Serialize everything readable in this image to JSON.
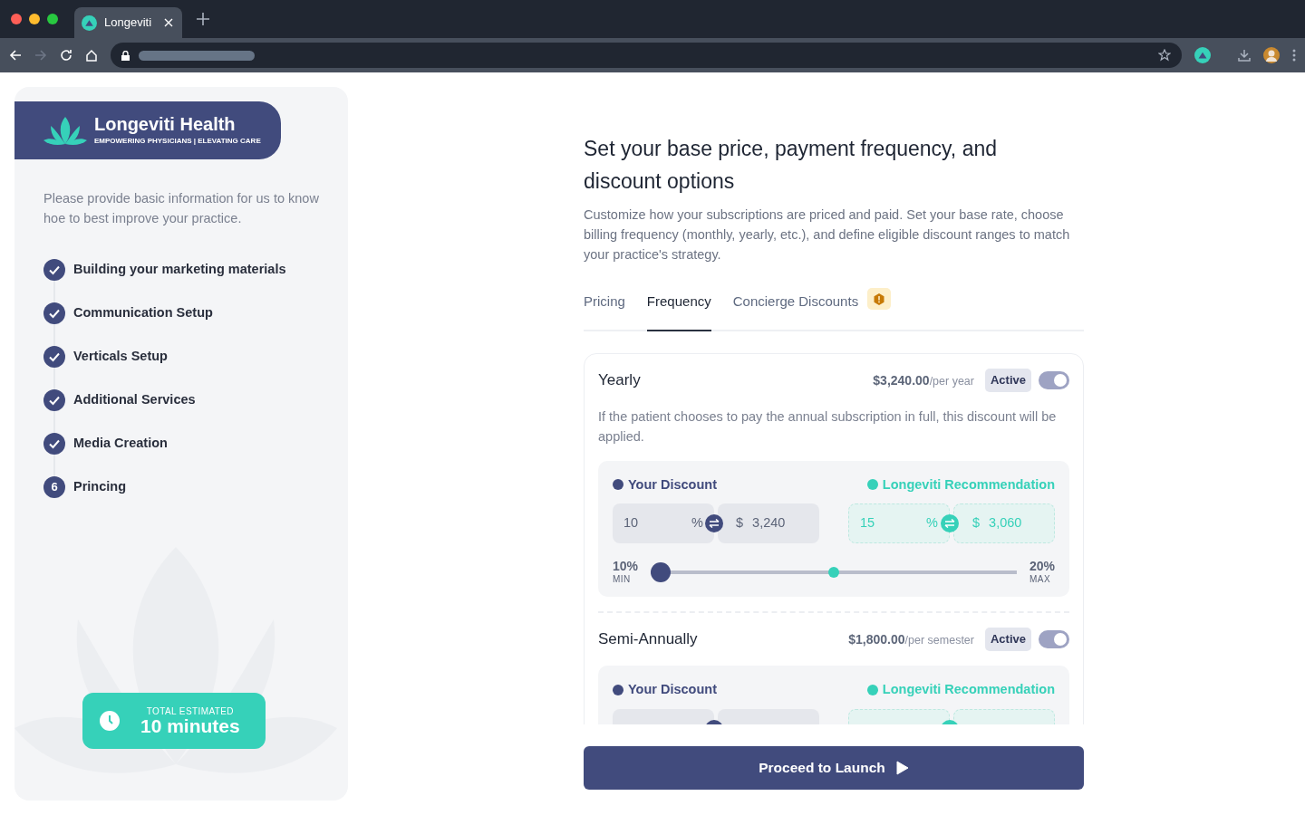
{
  "browser": {
    "tab_title": "Longeviti"
  },
  "sidebar": {
    "brand": "Longeviti Health",
    "tagline": "EMPOWERING PHYSICIANS | ELEVATING CARE",
    "intro": "Please provide basic information for us to know hoe to best improve your practice.",
    "steps": [
      {
        "label": "Building your marketing materials",
        "done": true
      },
      {
        "label": "Communication Setup",
        "done": true
      },
      {
        "label": "Verticals Setup",
        "done": true
      },
      {
        "label": "Additional Services",
        "done": true
      },
      {
        "label": "Media Creation",
        "done": true
      },
      {
        "label": "Princing",
        "done": false,
        "number": "6"
      }
    ],
    "estimate": {
      "label": "TOTAL ESTIMATED",
      "value": "10 minutes"
    }
  },
  "main": {
    "title": "Set your base price, payment frequency, and discount options",
    "description": "Customize how your subscriptions are priced and paid. Set your base rate, choose billing frequency (monthly, yearly, etc.), and define eligible discount ranges to match your practice's strategy.",
    "tabs": [
      {
        "label": "Pricing",
        "selected": false,
        "warning": false
      },
      {
        "label": "Frequency",
        "selected": true,
        "warning": false
      },
      {
        "label": "Concierge Discounts",
        "selected": false,
        "warning": true
      }
    ],
    "frequencies": [
      {
        "name": "Yearly",
        "price": "$3,240.00",
        "unit": "/per year",
        "status": "Active",
        "on": true,
        "description": "If the patient chooses to pay the annual subscription in full, this discount will be applied.",
        "discount": {
          "your_label": "Your Discount",
          "your_percent": "10",
          "your_amount": "3,240",
          "rec_label": "Longeviti Recommendation",
          "rec_percent": "15",
          "rec_amount": "3,060",
          "percent_sign": "%",
          "currency": "$",
          "min": "10%",
          "min_label": "MIN",
          "max": "20%",
          "max_label": "MAX",
          "slider": {
            "level": 0
          },
          "recommended_marker": {
            "level": 0.5
          }
        }
      },
      {
        "name": "Semi-Annually",
        "price": "$1,800.00",
        "unit": "/per semester",
        "status": "Active",
        "on": true,
        "discount": {
          "your_label": "Your Discount",
          "rec_label": "Longeviti Recommendation"
        }
      }
    ],
    "proceed_button": "Proceed to Launch"
  }
}
